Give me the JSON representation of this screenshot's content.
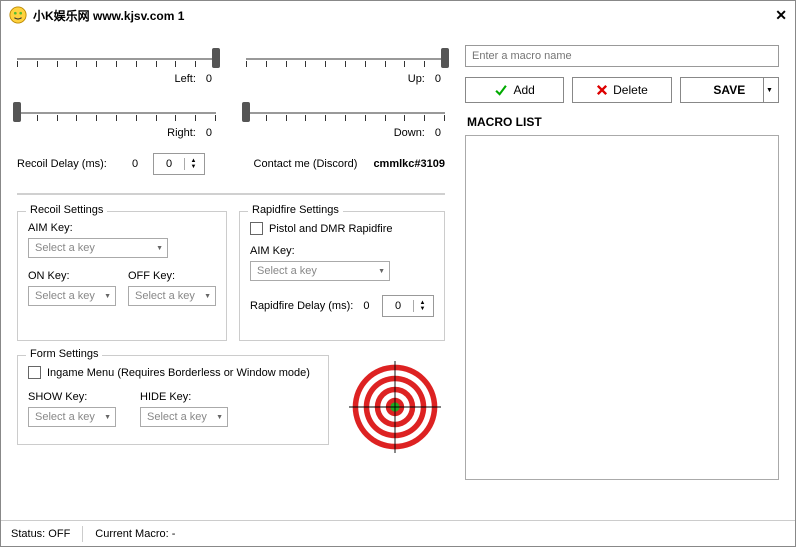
{
  "title": "小K娱乐网 www.kjsv.com    1",
  "sliders": {
    "left": {
      "label": "Left:",
      "value": "0"
    },
    "right": {
      "label": "Right:",
      "value": "0"
    },
    "up": {
      "label": "Up:",
      "value": "0"
    },
    "down": {
      "label": "Down:",
      "value": "0"
    }
  },
  "recoilDelay": {
    "label": "Recoil Delay (ms):",
    "value": "0",
    "spinner": "0"
  },
  "contact": {
    "label": "Contact me (Discord)",
    "value": "cmmlkc#3109"
  },
  "recoilSettings": {
    "legend": "Recoil Settings",
    "aimKey": {
      "label": "AIM Key:",
      "placeholder": "Select a key"
    },
    "onKey": {
      "label": "ON Key:",
      "placeholder": "Select a key"
    },
    "offKey": {
      "label": "OFF Key:",
      "placeholder": "Select a key"
    }
  },
  "rapidfire": {
    "legend": "Rapidfire Settings",
    "checkbox": "Pistol and DMR Rapidfire",
    "aimKey": {
      "label": "AIM Key:",
      "placeholder": "Select a key"
    },
    "delay": {
      "label": "Rapidfire Delay (ms):",
      "value": "0",
      "spinner": "0"
    }
  },
  "formSettings": {
    "legend": "Form Settings",
    "checkbox": "Ingame Menu (Requires Borderless or Window mode)",
    "showKey": {
      "label": "SHOW Key:",
      "placeholder": "Select a key"
    },
    "hideKey": {
      "label": "HIDE Key:",
      "placeholder": "Select a key"
    }
  },
  "macro": {
    "placeholder": "Enter a macro name",
    "add": "Add",
    "delete": "Delete",
    "save": "SAVE",
    "listHeader": "MACRO LIST"
  },
  "status": {
    "status": "Status: OFF",
    "current": "Current Macro: -"
  }
}
